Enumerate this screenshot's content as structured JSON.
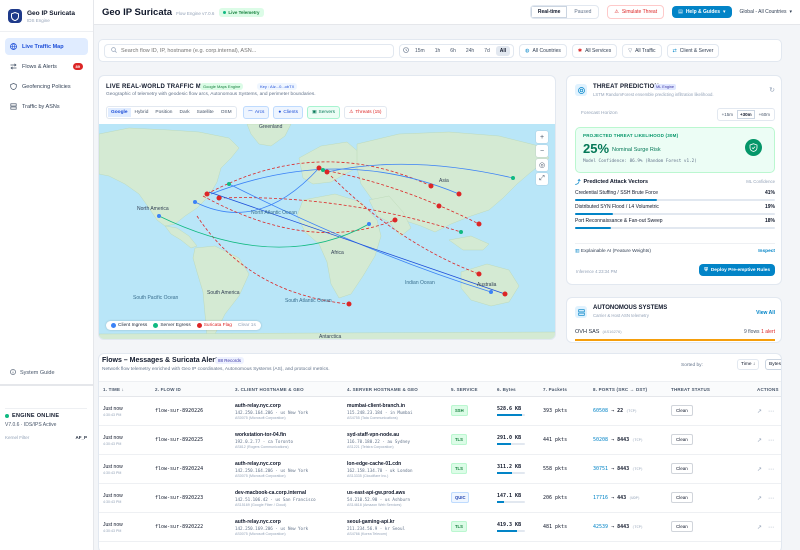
{
  "brand": {
    "title": "Geo IP Suricata",
    "sub": "IDS Engine"
  },
  "nav": [
    {
      "label": "Live Traffic Map",
      "active": true
    },
    {
      "label": "Flows & Alerts",
      "badge": "89"
    },
    {
      "label": "Geofencing Policies"
    },
    {
      "label": "Traffic by ASNs"
    }
  ],
  "sidebar_footer": {
    "guide": "System Guide",
    "engine_status": "ENGINE ONLINE",
    "engine_version": "V7.0.6 · IDS/IPS Active",
    "kernel_label": "Kernel Filter",
    "kernel_value": "AF_P"
  },
  "topbar": {
    "title": "Geo IP Suricata",
    "engine": "Flow Engine v7.0.6",
    "live": "Live Telemetry",
    "realtime": "Real-time",
    "paused": "Paused",
    "simulate": "Simulate Threat",
    "help": "Help & Guides",
    "region": "Global - All Countries"
  },
  "filters": {
    "search_placeholder": "Search flow ID, IP, hostname (e.g. corp.internal), ASN...",
    "times": [
      "15m",
      "1h",
      "6h",
      "24h",
      "7d",
      "All"
    ],
    "countries": "All Countries",
    "services": "All Services",
    "traffic": "All Traffic",
    "direction": "Client & Server"
  },
  "map": {
    "title": "LIVE REAL-WORLD TRAFFIC MAP",
    "engine_tag": "Google Maps Engine",
    "key_tag": "Key : AIz...0...obTX",
    "desc": "Geographic of telemetry with geodesic flow arcs, Autonomous Systems, and perimeter boundaries.",
    "styles": [
      "Google",
      "Hybrid",
      "Position",
      "Dark",
      "Satellite",
      "OSM"
    ],
    "layers": [
      "Arcs",
      "Clients",
      "Servers",
      "Threats (15)"
    ],
    "labels": {
      "greenland": "Greenland",
      "north_america": "North America",
      "north_atlantic": "North Atlantic Ocean",
      "south_america": "South America",
      "south_pacific": "South Pacific Ocean",
      "south_atlantic": "South Atlantic Ocean",
      "africa": "Africa",
      "asia": "Asia",
      "indian": "Indian Ocean",
      "australia": "Australia",
      "antarctica": "Antarctica"
    },
    "legend": {
      "client": "Client Ingress",
      "server": "Server Egress",
      "flag": "Suricata Flag",
      "clear": "Clear 1s"
    }
  },
  "threat": {
    "title": "THREAT PREDICTION",
    "ml_tag": "ML Engine",
    "sub": "LSTM RandomForest ensemble predicting infiltration likelihood.",
    "forecast_label": "Forecast Horizon",
    "horizons": [
      "+15m",
      "+30m",
      "+60m"
    ],
    "likelihood_label": "PROJECTED THREAT LIKELIHOOD (30M)",
    "likelihood_value": "25%",
    "likelihood_desc": "Nominal Surge Risk",
    "confidence": "Model Confidence: 86.9% (Random Forest v1.2)",
    "vectors_title": "Predicted Attack Vectors",
    "vectors_meta": "ML Confidence",
    "vectors": [
      {
        "label": "Credential Stuffing / SSH Brute Force",
        "pct": "41%",
        "value": 0.41
      },
      {
        "label": "Distributed SYN Flood / L4 Volumetric",
        "pct": "19%",
        "value": 0.19
      },
      {
        "label": "Port Reconnaissance & Fan-out Sweep",
        "pct": "18%",
        "value": 0.18
      }
    ],
    "xai": "Explainable AI (Feature Weights)",
    "xai_link": "Inspect",
    "inference": "Inference 4:23:34 PM",
    "deploy": "Deploy Pre-emptive Rules"
  },
  "auto": {
    "title": "AUTONOMOUS SYSTEMS",
    "sub": "Carrier & Host ASN telemetry",
    "view_all": "View All",
    "top": {
      "name": "OVH SAS",
      "asn": "(AS16276)",
      "flows": "9 flows",
      "status": "1 alert"
    }
  },
  "flows": {
    "title": "Flows – Messages & Suricata Alerts",
    "records": "88 Records",
    "sub": "Network flow telemetry enriched with Geo IP coordinates, Autonomous Systems (AS), and protocol metrics.",
    "sorted_by": "Sorted by:",
    "sort": "Time ↓",
    "bytes_btn": "Bytes",
    "headers": [
      "1. TIME ↓",
      "2. FLOW ID",
      "3. CLIENT HOSTNAME & GEO",
      "4. SERVER HOSTNAME & GEO",
      "5. SERVICE",
      "6. Bytes",
      "7. Packets",
      "8. PORTS (SRC → DST)",
      "THREAT STATUS",
      "ACTIONS"
    ],
    "rows": [
      {
        "time": "Just now",
        "time_sub": "4:30:43 PM",
        "id": "flow-sur-8920226",
        "client": "auth-relay.nyc.corp",
        "client_ip": "142.250.164.206 · us New York",
        "client_as": "AS0075 (Microsoft Corporation)",
        "server": "mumbai-client-branch.in",
        "server_ip": "115.248.23.184 · in Mumbai",
        "server_as": "AS4755 (Tata Communications)",
        "svc": "SSH",
        "bytes": "528.6 KB",
        "bytes_pct": 0.9,
        "packets": "393 pkts",
        "src": "60508",
        "dst": "22",
        "proto": "(TCP)",
        "status": "Clean"
      },
      {
        "time": "Just now",
        "time_sub": "4:30:43 PM",
        "id": "flow-sur-8920225",
        "client": "workstation-tor-04.fin",
        "client_ip": "192.0.2.77 · ca Toronto",
        "client_as": "AS812 (Rogers Communications)",
        "server": "syd-staff-vpn-node.au",
        "server_ip": "116.70.180.22 · au Sydney",
        "server_as": "AS1221 (Telstra Corporation)",
        "svc": "TLS",
        "bytes": "291.0 KB",
        "bytes_pct": 0.5,
        "packets": "441 pkts",
        "src": "50208",
        "dst": "8443",
        "proto": "(TCP)",
        "status": "Clean"
      },
      {
        "time": "Just now",
        "time_sub": "4:30:43 PM",
        "id": "flow-sur-8920224",
        "client": "auth-relay.nyc.corp",
        "client_ip": "142.250.164.206 · us New York",
        "client_as": "AS0075 (Microsoft Corporation)",
        "server": "lon-edge-cache-01.cdn",
        "server_ip": "162.158.134.70 · uk London",
        "server_as": "AS13335 (Cloudflare Inc.)",
        "svc": "TLS",
        "bytes": "311.2 KB",
        "bytes_pct": 0.55,
        "packets": "558 pkts",
        "src": "30751",
        "dst": "8443",
        "proto": "(TCP)",
        "status": "Clean"
      },
      {
        "time": "Just now",
        "time_sub": "4:30:43 PM",
        "id": "flow-sur-8920223",
        "client": "dev-macbook-ca.corp.internal",
        "client_ip": "142.51.106.42 · us San Francisco",
        "client_as": "AS15169 (Google Fiber / Cloud)",
        "server": "us-east-api-gw.prod.aws",
        "server_ip": "54.210.52.90 · us Ashburn",
        "server_as": "AS14618 (Amazon Web Services)",
        "svc": "QUIC",
        "bytes": "147.1 KB",
        "bytes_pct": 0.25,
        "packets": "206 pkts",
        "src": "17716",
        "dst": "443",
        "proto": "(UDP)",
        "status": "Clean"
      },
      {
        "time": "Just now",
        "time_sub": "4:30:43 PM",
        "id": "flow-sur-8920222",
        "client": "auth-relay.nyc.corp",
        "client_ip": "142.250.169.206 · us New York",
        "client_as": "AS0075 (Microsoft Corporation)",
        "server": "seoul-gaming-api.kr",
        "server_ip": "211.234.56.9 · kr Seoul",
        "server_as": "AS4766 (Korea Telecom)",
        "svc": "TLS",
        "bytes": "419.3 KB",
        "bytes_pct": 0.72,
        "packets": "481 pkts",
        "src": "42539",
        "dst": "8443",
        "proto": "(TCP)",
        "status": "Clean"
      }
    ]
  }
}
